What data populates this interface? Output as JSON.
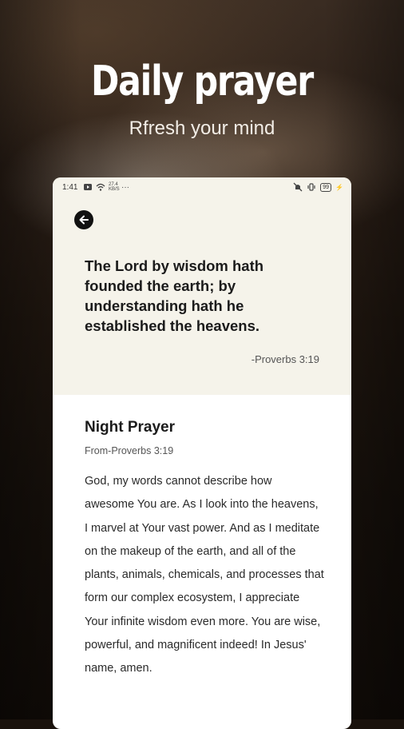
{
  "hero": {
    "title": "Daily prayer",
    "subtitle": "Rfresh your mind"
  },
  "status_bar": {
    "time": "1:41",
    "network_speed": "27.4\nKB/S",
    "battery": "99"
  },
  "verse": {
    "text": "The Lord by wisdom hath founded the earth; by understanding hath he established the heavens.",
    "reference": "-Proverbs 3:19"
  },
  "prayer": {
    "title": "Night Prayer",
    "source": "From-Proverbs 3:19",
    "body": "God, my words cannot describe how awesome You are. As I look into the heavens, I marvel at Your vast power. And as I meditate on the makeup of the earth, and all of the plants, animals, chemicals, and processes that form our complex ecosystem, I appreciate Your infinite wisdom even more. You are wise, powerful, and magnificent indeed! In Jesus' name, amen."
  },
  "icons": {
    "back": "arrow-left-icon"
  }
}
